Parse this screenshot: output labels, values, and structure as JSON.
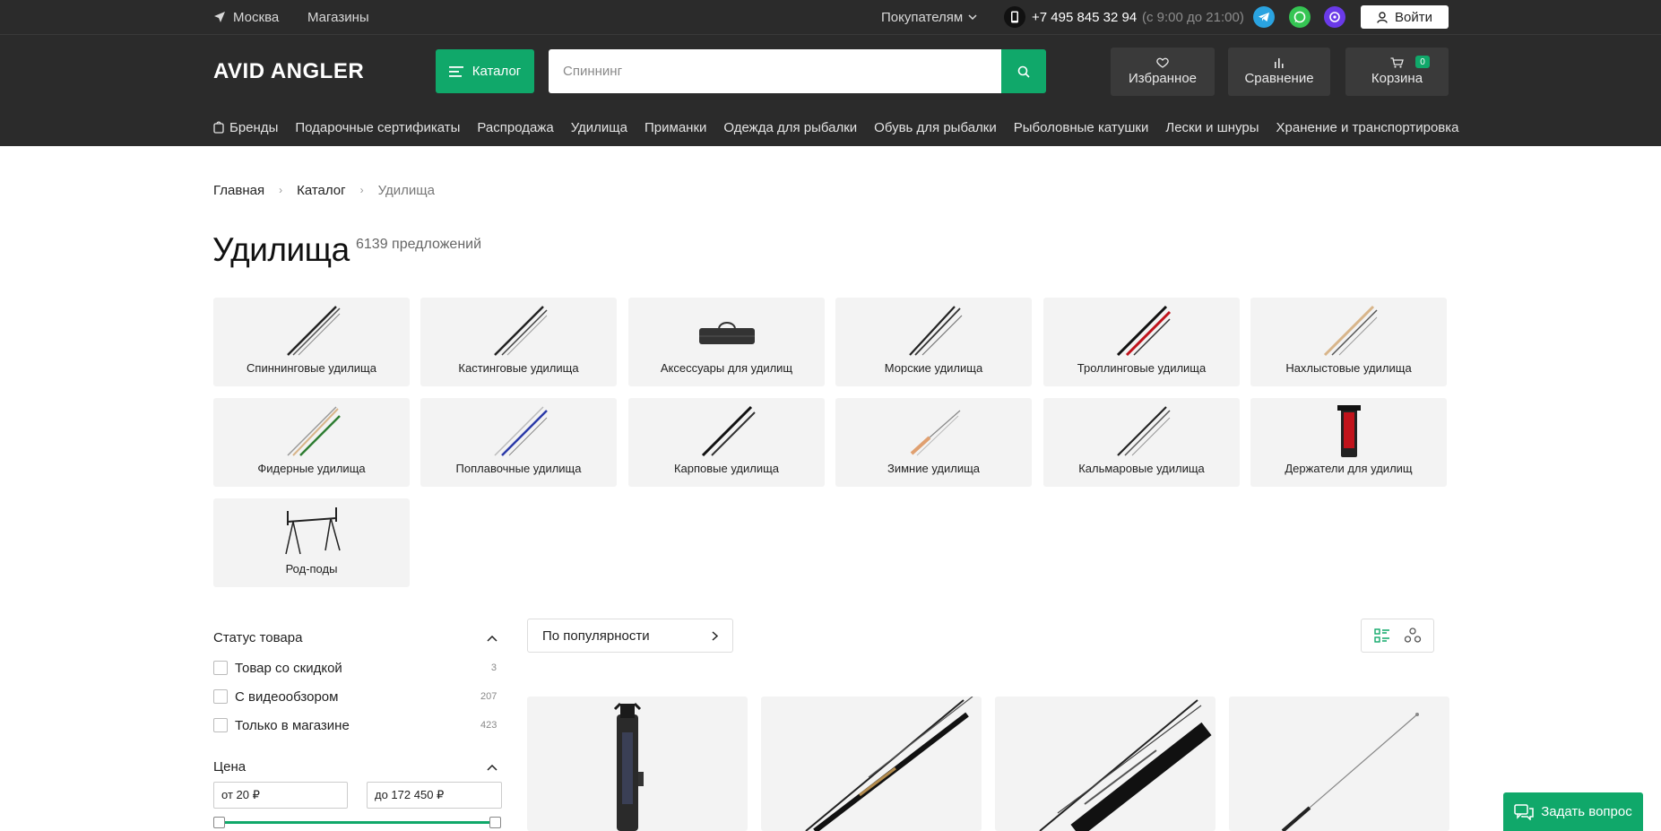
{
  "topbar": {
    "city": "Москва",
    "stores": "Магазины",
    "buyers": "Покупателям",
    "phone": "+7 495 845 32 94",
    "hours": "(с 9:00 до 21:00)",
    "login": "Войти"
  },
  "header": {
    "logo": "AVID ANGLER",
    "catalog_label": "Каталог",
    "search_placeholder": "Спиннинг",
    "favorites": "Избранное",
    "compare": "Сравнение",
    "cart": "Корзина",
    "cart_count": "0",
    "accent": "#10a86a"
  },
  "nav": [
    "Бренды",
    "Подарочные сертификаты",
    "Распродажа",
    "Удилища",
    "Приманки",
    "Одежда для рыбалки",
    "Обувь для рыбалки",
    "Рыболовные катушки",
    "Лески и шнуры",
    "Хранение и транспортировка"
  ],
  "breadcrumb": [
    "Главная",
    "Каталог",
    "Удилища"
  ],
  "page": {
    "title": "Удилища",
    "offers": "6139 предложений"
  },
  "categories": [
    "Спиннинговые удилища",
    "Кастинговые удилища",
    "Аксессуары для удилищ",
    "Морские удилища",
    "Троллинговые удилища",
    "Нахлыстовые удилища",
    "Фидерные удилища",
    "Поплавочные удилища",
    "Карповые удилища",
    "Зимние удилища",
    "Кальмаровые удилища",
    "Держатели для удилищ",
    "Род-поды"
  ],
  "filters": {
    "status_title": "Статус товара",
    "options": [
      {
        "label": "Товар со скидкой",
        "count": "3"
      },
      {
        "label": "С видеообзором",
        "count": "207"
      },
      {
        "label": "Только в магазине",
        "count": "423"
      }
    ],
    "price_title": "Цена",
    "price_from": "от 20 ₽",
    "price_to": "до 172 450 ₽"
  },
  "sort": {
    "label": "По популярности"
  },
  "ask": "Задать вопрос"
}
